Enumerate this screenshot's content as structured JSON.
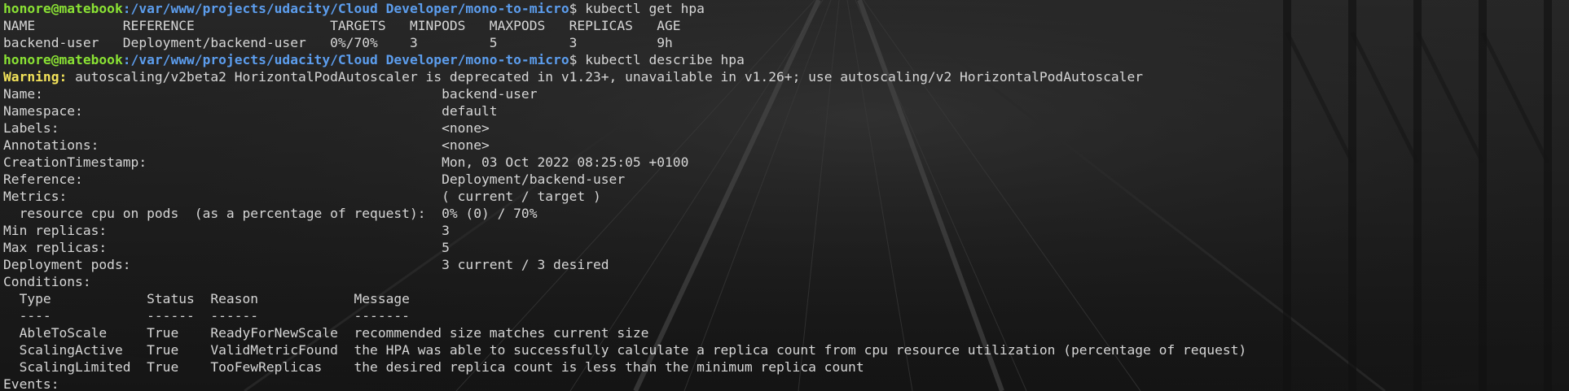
{
  "prompt": {
    "user_host": "honore@matebook",
    "path": ":/var/www/projects/udacity/Cloud Developer/mono-to-micro",
    "symbol": "$ "
  },
  "commands": {
    "get_hpa": "kubectl get hpa",
    "describe_hpa": "kubectl describe hpa"
  },
  "get_hpa_table": {
    "header": "NAME           REFERENCE                 TARGETS   MINPODS   MAXPODS   REPLICAS   AGE",
    "rows": [
      "backend-user   Deployment/backend-user   0%/70%    3         5         3          9h"
    ]
  },
  "warning": {
    "label": "Warning:",
    "text": " autoscaling/v2beta2 HorizontalPodAutoscaler is deprecated in v1.23+, unavailable in v1.26+; use autoscaling/v2 HorizontalPodAutoscaler"
  },
  "describe": {
    "fields": [
      "Name:                                                  backend-user",
      "Namespace:                                             default",
      "Labels:                                                <none>",
      "Annotations:                                           <none>",
      "CreationTimestamp:                                     Mon, 03 Oct 2022 08:25:05 +0100",
      "Reference:                                             Deployment/backend-user",
      "Metrics:                                               ( current / target )",
      "  resource cpu on pods  (as a percentage of request):  0% (0) / 70%",
      "Min replicas:                                          3",
      "Max replicas:                                          5",
      "Deployment pods:                                       3 current / 3 desired",
      "Conditions:"
    ],
    "conditions": {
      "header": "  Type            Status  Reason            Message",
      "separator": "  ----            ------  ------            -------",
      "rows": [
        "  AbleToScale     True    ReadyForNewScale  recommended size matches current size",
        "  ScalingActive   True    ValidMetricFound  the HPA was able to successfully calculate a replica count from cpu resource utilization (percentage of request)",
        "  ScalingLimited  True    TooFewReplicas    the desired replica count is less than the minimum replica count"
      ]
    },
    "events_label": "Events:"
  }
}
